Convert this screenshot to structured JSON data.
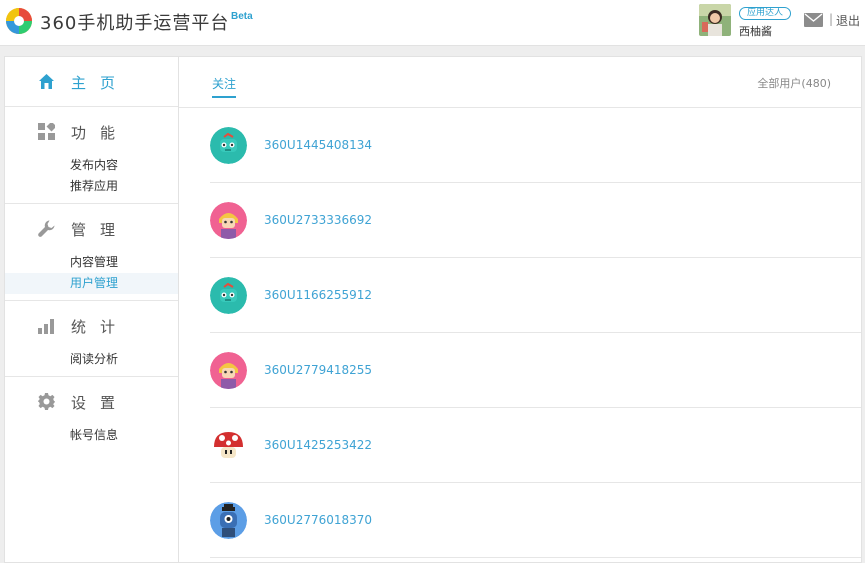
{
  "header": {
    "logo_text": "360手机助手运营平台",
    "logo_beta": "Beta",
    "user_badge": "应用达人",
    "user_name": "西柚酱",
    "separator": "|",
    "logout": "退出"
  },
  "sidebar": {
    "home": "主页",
    "groups": [
      {
        "title": "功能",
        "icon": "grid-icon",
        "items": [
          {
            "label": "发布内容"
          },
          {
            "label": "推荐应用"
          }
        ]
      },
      {
        "title": "管理",
        "icon": "wrench-icon",
        "items": [
          {
            "label": "内容管理"
          },
          {
            "label": "用户管理",
            "active": true
          }
        ]
      },
      {
        "title": "统计",
        "icon": "bar-chart-icon",
        "items": [
          {
            "label": "阅读分析"
          }
        ]
      },
      {
        "title": "设置",
        "icon": "gear-icon",
        "items": [
          {
            "label": "帐号信息"
          }
        ]
      }
    ]
  },
  "main": {
    "tab_follow": "关注",
    "total_label": "全部用户(480)",
    "users": [
      {
        "name": "360U1445408134",
        "avatar": "teal-robot-avatar"
      },
      {
        "name": "360U2733336692",
        "avatar": "pink-blonde-avatar"
      },
      {
        "name": "360U1166255912",
        "avatar": "teal-robot-avatar"
      },
      {
        "name": "360U2779418255",
        "avatar": "pink-blonde-avatar"
      },
      {
        "name": "360U1425253422",
        "avatar": "mushroom-avatar"
      },
      {
        "name": "360U2776018370",
        "avatar": "blue-monster-avatar"
      }
    ]
  },
  "colors": {
    "accent": "#2ea1cf",
    "link": "#3fa3d4",
    "background": "#eeeeee"
  }
}
